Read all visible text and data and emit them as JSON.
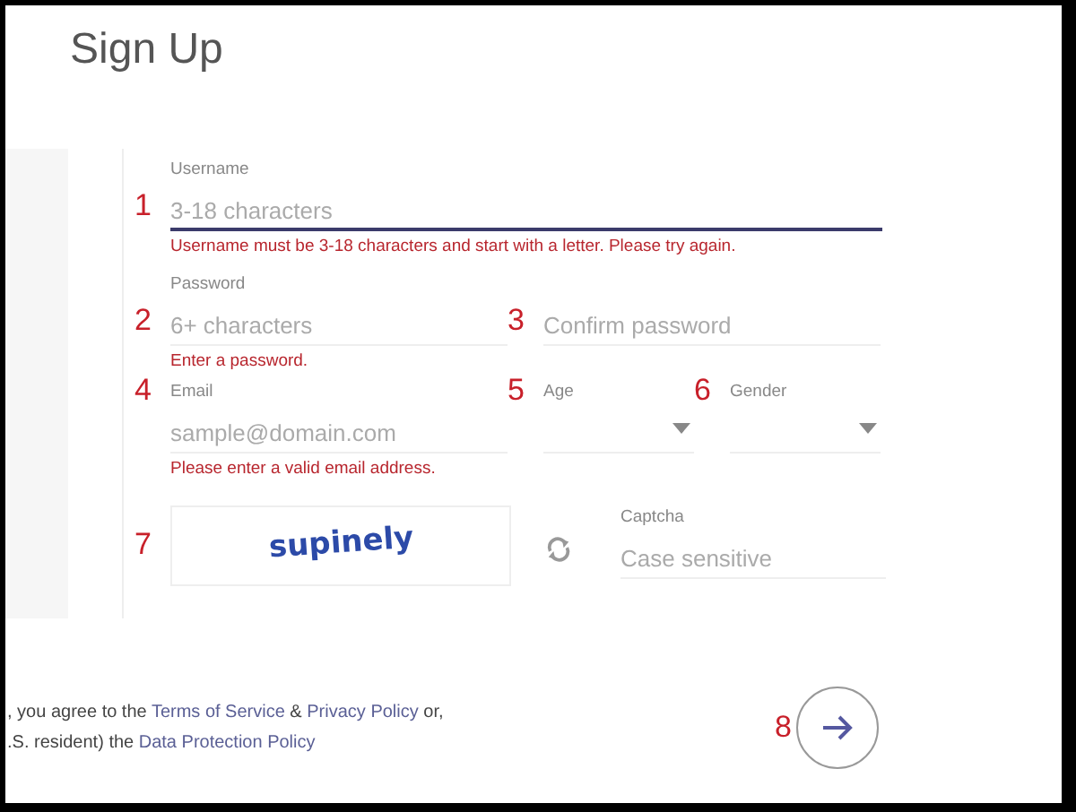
{
  "title": "Sign Up",
  "rows": [
    {
      "fields": [
        {
          "kind": "text",
          "annotation": "1",
          "label": "Username",
          "placeholder": "3-18 characters",
          "focused": true,
          "error": "Username must be 3-18 characters and start with a letter. Please try again."
        }
      ]
    },
    {
      "fields": [
        {
          "kind": "text",
          "annotation": "2",
          "label": "Password",
          "placeholder": "6+ characters",
          "focused": false,
          "error": "Enter a password."
        },
        {
          "kind": "text",
          "annotation": "3",
          "placeholder": "Confirm password",
          "focused": false
        }
      ]
    },
    {
      "fields": [
        {
          "kind": "text",
          "annotation": "4",
          "label": "Email",
          "placeholder": "sample@domain.com",
          "focused": false,
          "error": "Please enter a valid email address."
        },
        {
          "kind": "select",
          "annotation": "5",
          "label": "Age"
        },
        {
          "kind": "select",
          "annotation": "6",
          "label": "Gender"
        }
      ]
    }
  ],
  "captcha": {
    "annotation": "7",
    "image_text": "supinely",
    "label": "Captcha",
    "placeholder": "Case sensitive"
  },
  "terms": [
    [
      {
        "text": ", you agree to the "
      },
      {
        "text": "Terms of Service",
        "link": true
      },
      {
        "text": " & "
      },
      {
        "text": "Privacy Policy",
        "link": true
      },
      {
        "text": " or,"
      }
    ],
    [
      {
        "text": ".S. resident) the "
      },
      {
        "text": "Data Protection Policy",
        "link": true
      }
    ]
  ],
  "submit": {
    "annotation": "8"
  }
}
